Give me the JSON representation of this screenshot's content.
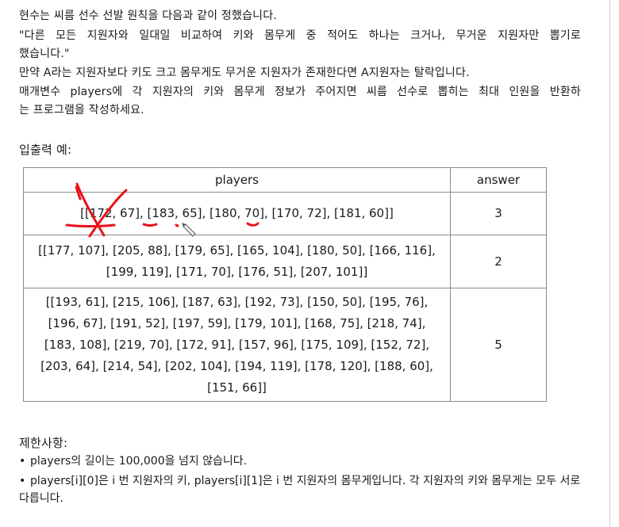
{
  "intro": {
    "line1": "현수는 씨름 선수 선발 원칙을 다음과 같이 정했습니다.",
    "line2": "\"다른 모든 지원자와 일대일 비교하여 키와 몸무게 중 적어도 하나는 크거나, 무거운 지원자만 뽑기로",
    "line3": "했습니다.\"",
    "line4": "만약 A라는 지원자보다 키도 크고 몸무게도 무거운 지원자가 존재한다면 A지원자는 탈락입니다.",
    "line5": "매개변수 players에 각 지원자의 키와 몸무게 정보가 주어지면 씨름 선수로 뽑히는 최대 인원을 반환하",
    "line6": "는 프로그램을 작성하세요."
  },
  "examples": {
    "heading": "입출력 예:",
    "headers": {
      "players": "players",
      "answer": "answer"
    },
    "rows": [
      {
        "players": "[[172, 67], [183, 65], [180, 70], [170, 72], [181, 60]]",
        "answer": "3"
      },
      {
        "players": "[[177, 107], [205, 88], [179, 65], [165, 104], [180, 50], [166, 116], [199, 119], [171, 70], [176, 51], [207, 101]]",
        "answer": "2"
      },
      {
        "players": "[[193, 61], [215, 106], [187, 63], [192, 73], [150, 50], [195, 76], [196, 67], [191, 52], [197, 59], [179, 101], [168, 75], [218, 74], [183, 108], [219, 70], [172, 91], [157, 96], [175, 109], [152, 72], [203, 64], [214, 54], [202, 104], [194, 119], [178, 120], [188, 60], [151, 66]]",
        "answer": "5"
      }
    ]
  },
  "constraints": {
    "heading": "제한사항:",
    "bullet_symbol": "•",
    "items": [
      "players의 길이는 100,000을 넘지 않습니다.",
      "players[i][0]은 i 번 지원자의 키, players[i][1]은 i 번 지원자의 몸무게입니다. 각 지원자의 키와 몸무게는 모두 서로 다릅니다."
    ]
  },
  "annotation_color": "#e8121b"
}
